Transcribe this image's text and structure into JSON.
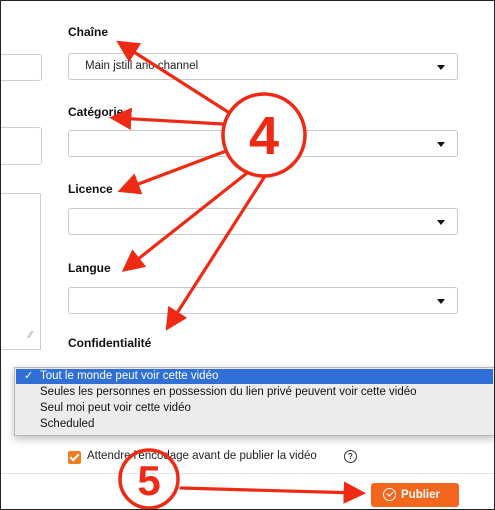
{
  "form": {
    "channel": {
      "label": "Chaîne",
      "value": "Main jstill ano channel"
    },
    "category": {
      "label": "Catégorie",
      "value": ""
    },
    "licence": {
      "label": "Licence",
      "value": ""
    },
    "language": {
      "label": "Langue",
      "value": ""
    },
    "privacy": {
      "label": "Confidentialité"
    }
  },
  "privacy_dropdown": {
    "options": [
      {
        "label": "Tout le monde peut voir cette vidéo",
        "selected": true
      },
      {
        "label": "Seules les personnes en possession du lien privé peuvent voir cette vidéo",
        "selected": false
      },
      {
        "label": "Seul moi peut voir cette vidéo",
        "selected": false
      },
      {
        "label": "Scheduled",
        "selected": false
      }
    ],
    "check_glyph": "✓"
  },
  "wait_transcoding": {
    "label": "Attendre l'encodage avant de publier la vidéo",
    "checked": true,
    "help_glyph": "?"
  },
  "publish": {
    "label": "Publier",
    "icon": "check-circle-icon"
  },
  "annotations": {
    "callout_4": "4",
    "callout_5": "5",
    "color": "#ef2a14"
  },
  "colors": {
    "accent": "#f2661e",
    "checkbox": "#f07d1f",
    "selection": "#2f6fd6"
  }
}
